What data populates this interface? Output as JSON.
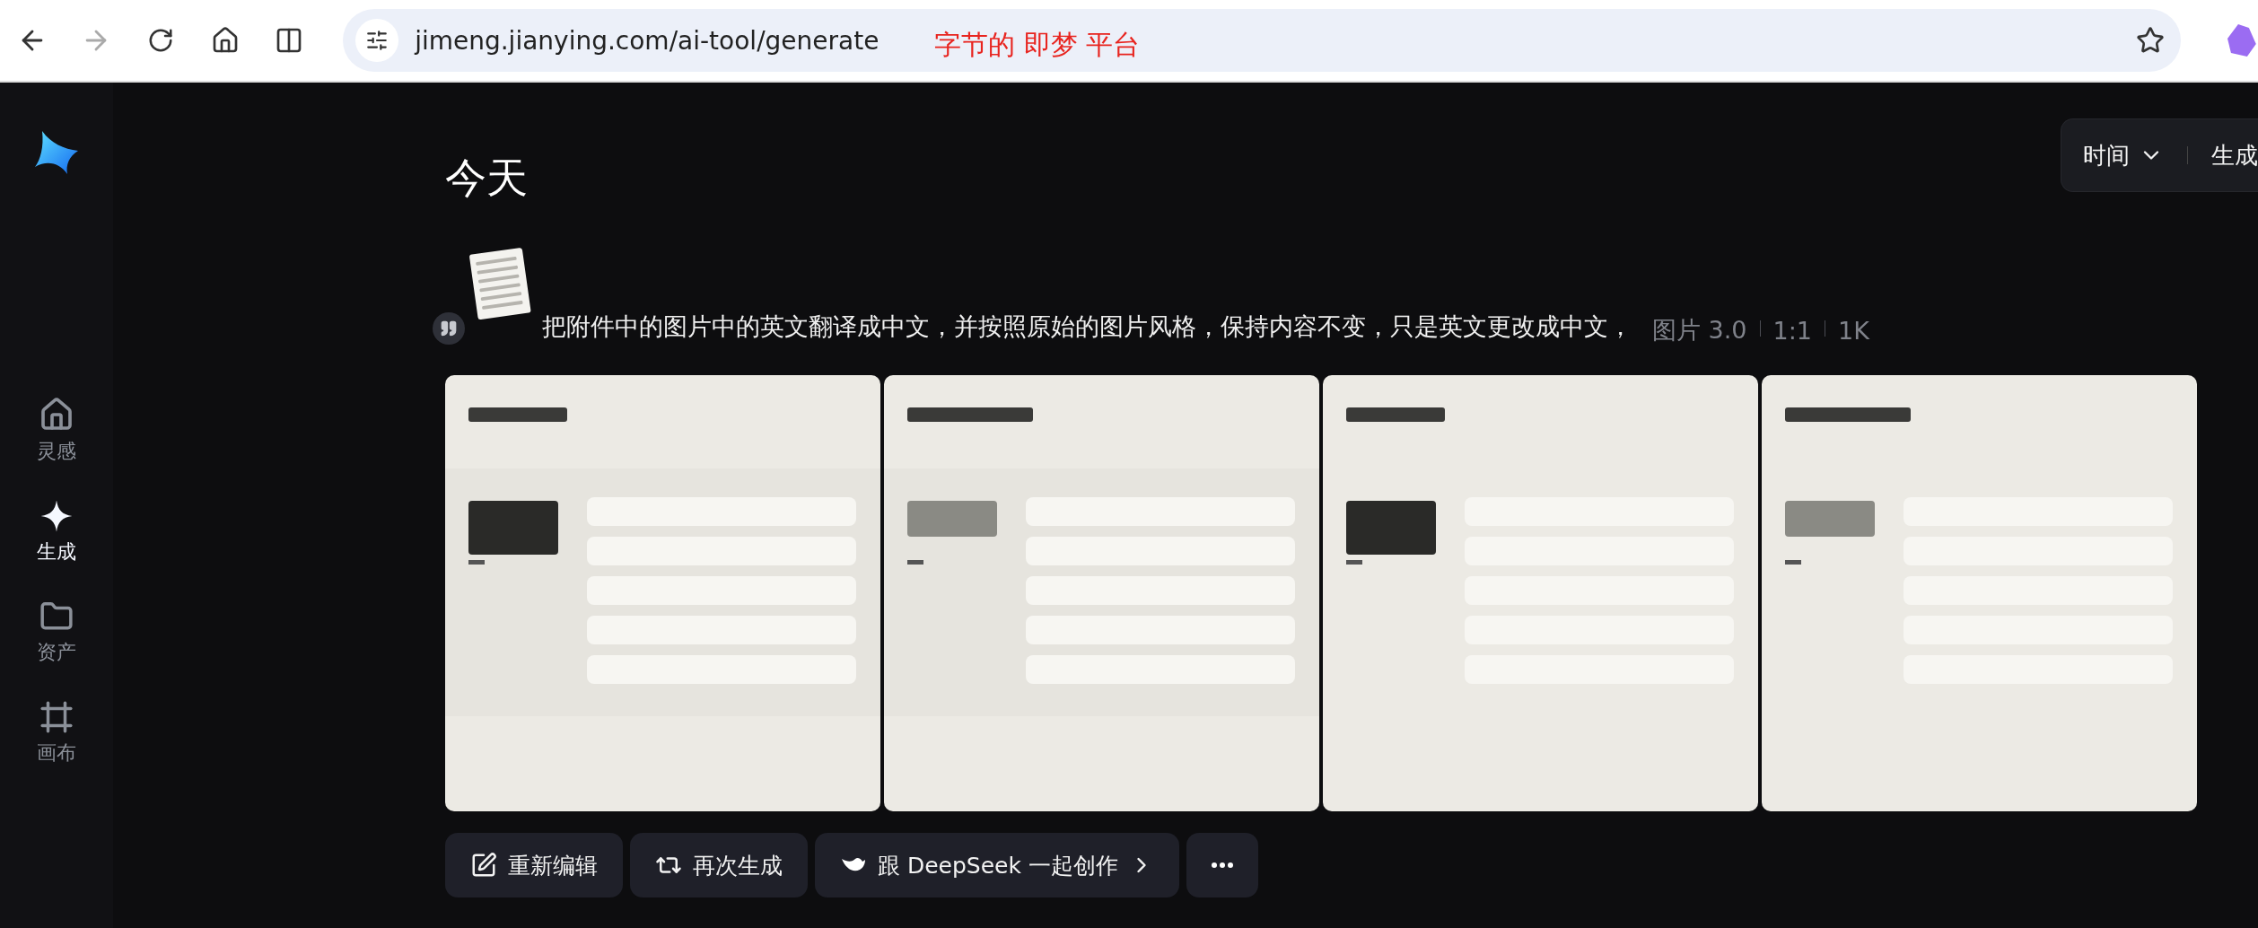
{
  "browser": {
    "url": "jimeng.jianying.com/ai-tool/generate",
    "annotation": "字节的 即梦 平台"
  },
  "sidebar": {
    "items": [
      {
        "label": "灵感",
        "selected": false
      },
      {
        "label": "生成",
        "selected": true
      },
      {
        "label": "资产",
        "selected": false
      },
      {
        "label": "画布",
        "selected": false
      }
    ]
  },
  "filters": [
    {
      "label": "时间",
      "dropdown": true
    },
    {
      "label": "生成",
      "dropdown": false
    }
  ],
  "section_title": "今天",
  "prompt": {
    "text": "把附件中的图片中的英文翻译成中文，并按照原始的图片风格，保持内容不变，只是英文更改成中文，",
    "meta": [
      "图片 3.0",
      "1:1",
      "1K"
    ]
  },
  "actions": [
    {
      "label": "重新编辑",
      "chevron": false
    },
    {
      "label": "再次生成",
      "chevron": false
    },
    {
      "label": "跟 DeepSeek 一起创作",
      "chevron": true
    }
  ]
}
